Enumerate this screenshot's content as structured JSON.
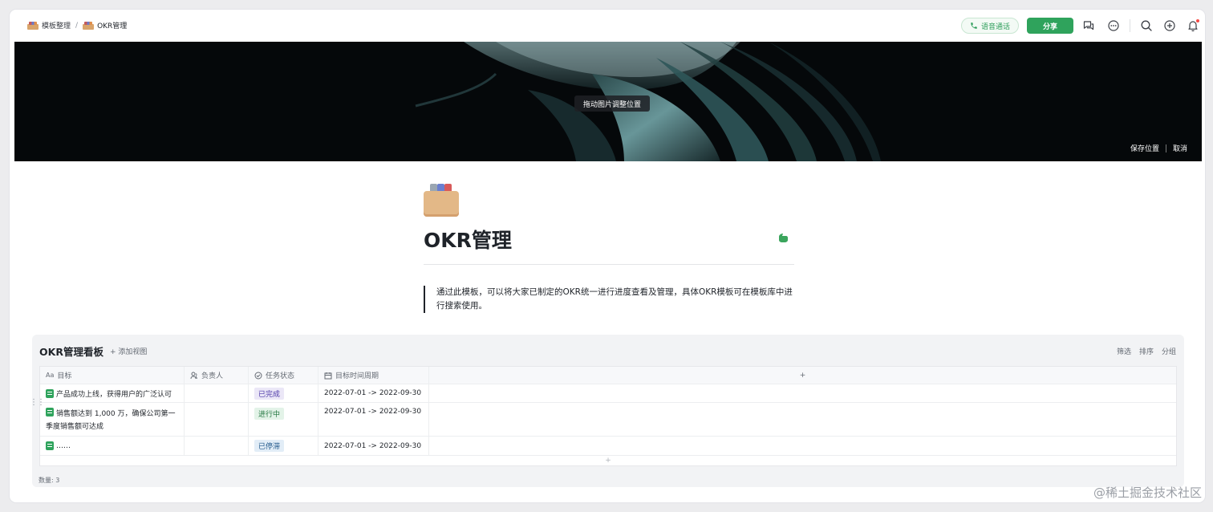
{
  "breadcrumb": {
    "parent": "模板整理",
    "separator": "/",
    "current": "OKR管理"
  },
  "topbar": {
    "call_label": "语音通话",
    "share_label": "分享"
  },
  "cover": {
    "drag_tip": "拖动图片调整位置",
    "save_position": "保存位置",
    "cancel": "取消"
  },
  "page": {
    "title": "OKR管理",
    "quote": "通过此模板，可以将大家已制定的OKR统一进行进度查看及管理，具体OKR模板可在模板库中进行搜索使用。"
  },
  "board": {
    "title": "OKR管理看板",
    "add_view": "+ 添加视图",
    "tools": [
      "筛选",
      "排序",
      "分组"
    ],
    "columns": [
      {
        "icon": "Aa",
        "label": "目标"
      },
      {
        "icon": "person",
        "label": "负责人"
      },
      {
        "icon": "status",
        "label": "任务状态"
      },
      {
        "icon": "calendar",
        "label": "目标时间周期"
      }
    ],
    "add_column": "+",
    "rows": [
      {
        "goal": "产品成功上线，获得用户的广泛认可",
        "owner": "",
        "status": "已完成",
        "status_bg": "#ebe7f7",
        "status_color": "#4e3aa8",
        "period": "2022-07-01 -> 2022-09-30"
      },
      {
        "goal": "销售额达到 1,000 万，确保公司第一季度销售额可达成",
        "owner": "",
        "status": "进行中",
        "status_bg": "#e3f3e8",
        "status_color": "#22763f",
        "period": "2022-07-01 -> 2022-09-30"
      },
      {
        "goal": "……",
        "owner": "",
        "status": "已停滞",
        "status_bg": "#e2edf7",
        "status_color": "#245a8c",
        "period": "2022-07-01 -> 2022-09-30"
      }
    ],
    "add_row": "+",
    "count": "数量: 3"
  },
  "watermark": "@稀土掘金技术社区",
  "colors": {
    "accent_green": "#2fa35c",
    "notification_dot": "#f54a45"
  }
}
